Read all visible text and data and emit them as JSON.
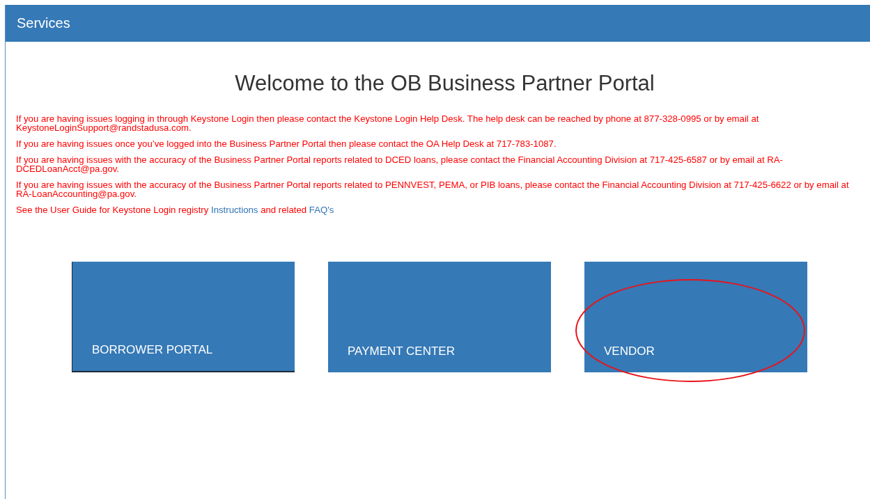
{
  "header": {
    "title": "Services"
  },
  "heading": "Welcome to the OB Business Partner Portal",
  "notices": [
    {
      "parts": [
        {
          "kind": "text",
          "text": "If you are having issues logging in through Keystone Login then please contact the Keystone Login Help Desk. The help desk can be reached by phone at 877-328-0995 or by email at KeystoneLoginSupport@randstadusa.com."
        }
      ]
    },
    {
      "parts": [
        {
          "kind": "text",
          "text": "If you are having issues once you’ve logged into the Business Partner Portal then please contact the OA Help Desk at 717-783-1087."
        }
      ]
    },
    {
      "parts": [
        {
          "kind": "text",
          "text": "If you are having issues with the accuracy of the Business Partner Portal reports related to DCED loans, please contact the Financial Accounting Division at 717-425-6587 or by email at RA-DCEDLoanAcct@pa.gov."
        }
      ]
    },
    {
      "parts": [
        {
          "kind": "text",
          "text": "If you are having issues with the accuracy of the Business Partner Portal reports related to PENNVEST, PEMA, or PIB loans, please contact the Financial Accounting Division at 717-425-6622 or by email at RA-LoanAccounting@pa.gov."
        }
      ]
    },
    {
      "parts": [
        {
          "kind": "text",
          "text": "See the User Guide for Keystone Login registry"
        },
        {
          "kind": "link",
          "text": "Instructions"
        },
        {
          "kind": "text",
          "text": "and related"
        },
        {
          "kind": "link",
          "text": "FAQ's"
        }
      ]
    }
  ],
  "tiles": [
    {
      "label": "BORROWER PORTAL",
      "focused": true,
      "circled": false
    },
    {
      "label": "PAYMENT CENTER",
      "focused": false,
      "circled": false
    },
    {
      "label": "VENDOR",
      "focused": false,
      "circled": true
    }
  ]
}
